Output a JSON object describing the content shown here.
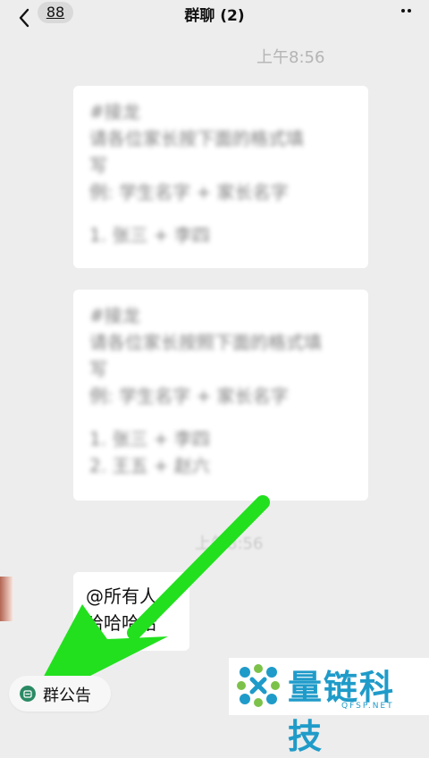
{
  "header": {
    "back_icon": "chevron-left-icon",
    "unread_count": "88",
    "title": "群聊 (2)",
    "more_icon": "ellipsis-icon"
  },
  "messages": {
    "time1": "上午8:56",
    "card1_lines": [
      "#接龙",
      "请各位家长按下面的格式填写",
      "例: 学生名字 + 家长名字",
      "",
      "1. 张三 + 李四"
    ],
    "card2_lines": [
      "#接龙",
      "请各位家长按照下面的格式填写",
      "例: 学生名字 + 家长名字",
      "",
      "1. 张三 + 李四",
      "2. 王五 + 赵六"
    ],
    "time2": "上午8:56",
    "bubble_line1": "@所有人",
    "bubble_line2": "哈哈哈哈"
  },
  "notice": {
    "icon": "group-notice-icon",
    "label": "群公告"
  },
  "overlay": {
    "arrow_icon": "green-arrow-icon",
    "arrow_color": "#22e01e"
  },
  "watermark": {
    "text": "量链科技",
    "sub": "QFSP.NET",
    "color": "#1f9bc9"
  }
}
